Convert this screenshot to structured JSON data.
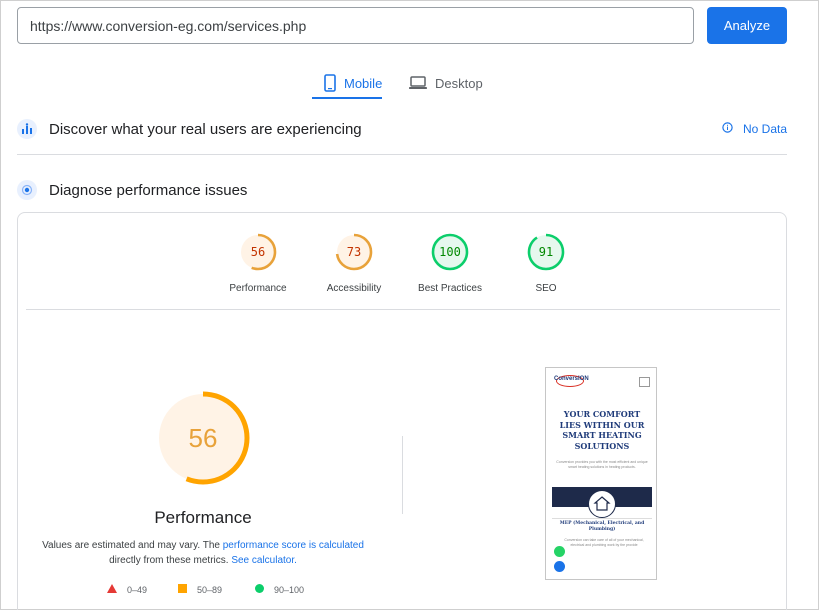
{
  "search": {
    "url_value": "https://www.conversion-eg.com/services.php",
    "analyze_label": "Analyze"
  },
  "tabs": [
    {
      "label": "Mobile",
      "icon": "mobile-icon",
      "selected": true
    },
    {
      "label": "Desktop",
      "icon": "desktop-icon",
      "selected": false
    }
  ],
  "discover": {
    "title": "Discover what your real users are experiencing",
    "icon": "users-chart-icon",
    "status": "No Data",
    "status_icon": "info-icon"
  },
  "diagnose": {
    "title": "Diagnose performance issues",
    "icon": "diagnose-icon"
  },
  "scores": [
    {
      "label": "Performance",
      "value": 56,
      "color": "#e8a23a",
      "text_color": "#c33300",
      "bg": "#fff3e6"
    },
    {
      "label": "Accessibility",
      "value": 73,
      "color": "#e8a23a",
      "text_color": "#c33300",
      "bg": "#fff3e6"
    },
    {
      "label": "Best Practices",
      "value": 100,
      "color": "#0cce6b",
      "text_color": "#008800",
      "bg": "#e6f8ee"
    },
    {
      "label": "SEO",
      "value": 91,
      "color": "#0cce6b",
      "text_color": "#008800",
      "bg": "#e6f8ee"
    }
  ],
  "main_score": {
    "value": 56,
    "label": "Performance",
    "color": "#ffa400"
  },
  "note": {
    "text_before": "Values are estimated and may vary. The ",
    "link1": "performance score is calculated",
    "text_middle": " directly from these metrics. ",
    "link2": "See calculator."
  },
  "legend": [
    {
      "shape": "triangle",
      "range": "0–49",
      "color": "#e53935"
    },
    {
      "shape": "square",
      "range": "50–89",
      "color": "#ffa400"
    },
    {
      "shape": "circle",
      "range": "90–100",
      "color": "#0cce6b"
    }
  ],
  "thumbnail": {
    "logo": "ConversION",
    "heading": "YOUR COMFORT LIES WITHIN OUR SMART HEATING SOLUTIONS",
    "small_text": "Conversion provides you with the most efficient and unique smart heating solutions in heating products.",
    "subheading": "MEP (Mechanical, Electrical, and Plumbing)",
    "small_text2": "Conversion can take care of all of your mechanical, electrical and plumbing work by the provide"
  }
}
